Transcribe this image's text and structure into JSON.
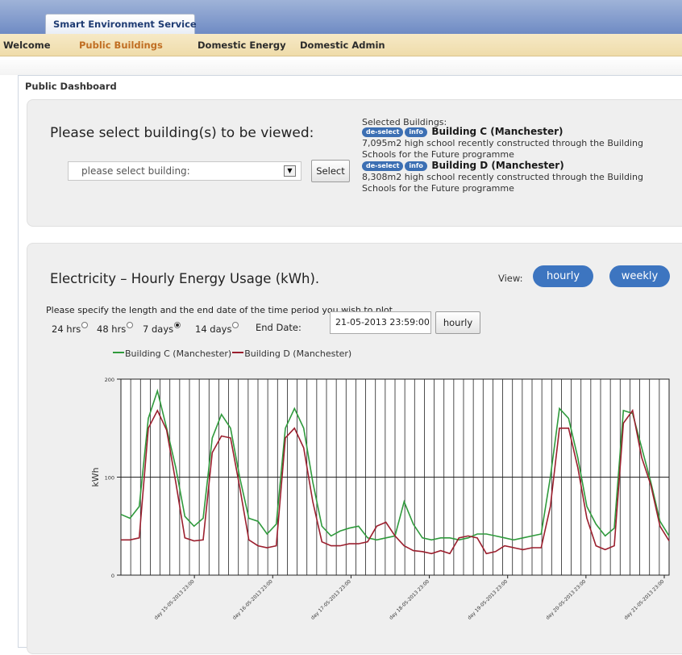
{
  "app": {
    "tab_title": "Smart Environment Service"
  },
  "nav": {
    "items": [
      {
        "label": "Welcome",
        "active": false
      },
      {
        "label": "Public Buildings",
        "active": true
      },
      {
        "label": "Domestic Energy",
        "active": false
      },
      {
        "label": "Domestic Admin",
        "active": false
      }
    ]
  },
  "dashboard": {
    "title": "Public Dashboard"
  },
  "building_select": {
    "heading": "Please select building(s) to be viewed:",
    "select_value": "please select building:",
    "select_button": "Select",
    "selected_label": "Selected Buildings:",
    "deselect_label": "de-select",
    "info_label": "info",
    "selected": [
      {
        "name": "Building C (Manchester)",
        "desc_line1": "7,095m2 high school recently constructed through the Building",
        "desc_line2": "Schools for the Future programme"
      },
      {
        "name": "Building D (Manchester)",
        "desc_line1": "8,308m2 high school recently constructed through the Building",
        "desc_line2": "Schools for the Future programme"
      }
    ]
  },
  "chart_panel": {
    "heading": "Electricity – Hourly Energy Usage (kWh).",
    "view_label": "View:",
    "view_hourly": "hourly",
    "view_weekly": "weekly",
    "period_text": "Please specify the length and the end date of the time period you wish to plot.",
    "options": [
      {
        "label": "24 hrs",
        "checked": false
      },
      {
        "label": "48 hrs",
        "checked": false
      },
      {
        "label": "7 days",
        "checked": true
      },
      {
        "label": "14 days",
        "checked": false
      }
    ],
    "end_date_label": "End Date:",
    "end_date_value": "21-05-2013 23:59:00",
    "plot_button": "hourly"
  },
  "colors": {
    "building_c": "#2f9a3c",
    "building_d": "#9b1f2e",
    "accent_blue": "#3d75c0",
    "menu_bg": "#f2e2b6"
  },
  "chart_data": {
    "type": "line",
    "title": "",
    "xlabel": "",
    "ylabel": "kWh",
    "ylim": [
      0,
      200
    ],
    "yticks": [
      "0",
      "100",
      "200"
    ],
    "legend_position": "top-left",
    "grid": "vertical",
    "xtick_labels": [
      "day 15-05-2013 23:00",
      "day 16-05-2013 23:00",
      "day 17-05-2013 23:00",
      "day 18-05-2013 23:00",
      "day 19-05-2013 23:00",
      "day 20-05-2013 23:00",
      "day 21-05-2013 23:00"
    ],
    "x_hours": [
      0,
      3,
      6,
      9,
      12,
      15,
      18,
      21,
      24,
      27,
      30,
      33,
      36,
      39,
      42,
      45,
      48,
      51,
      54,
      57,
      60,
      63,
      66,
      69,
      72,
      75,
      78,
      81,
      84,
      87,
      90,
      93,
      96,
      99,
      102,
      105,
      108,
      111,
      114,
      117,
      120,
      123,
      126,
      129,
      132,
      135,
      138,
      141,
      144,
      147,
      150,
      153,
      156,
      159,
      162,
      165,
      168
    ],
    "series": [
      {
        "name": "Building C (Manchester)",
        "values": [
          62,
          58,
          70,
          160,
          188,
          150,
          110,
          60,
          50,
          58,
          140,
          164,
          150,
          100,
          58,
          55,
          42,
          52,
          150,
          170,
          150,
          95,
          50,
          40,
          45,
          48,
          50,
          38,
          36,
          38,
          40,
          75,
          52,
          38,
          36,
          38,
          38,
          36,
          38,
          42,
          42,
          40,
          38,
          36,
          38,
          40,
          42,
          100,
          170,
          160,
          120,
          70,
          52,
          40,
          48,
          168,
          165,
          130,
          95,
          55,
          40
        ]
      },
      {
        "name": "Building D (Manchester)",
        "values": [
          36,
          36,
          38,
          150,
          168,
          148,
          95,
          38,
          35,
          36,
          125,
          142,
          140,
          90,
          36,
          30,
          28,
          30,
          140,
          150,
          130,
          75,
          34,
          30,
          30,
          32,
          32,
          34,
          50,
          54,
          40,
          30,
          25,
          24,
          22,
          25,
          22,
          38,
          40,
          38,
          22,
          24,
          30,
          28,
          26,
          28,
          28,
          70,
          150,
          150,
          110,
          58,
          30,
          26,
          30,
          155,
          168,
          120,
          92,
          50,
          35
        ]
      }
    ]
  }
}
